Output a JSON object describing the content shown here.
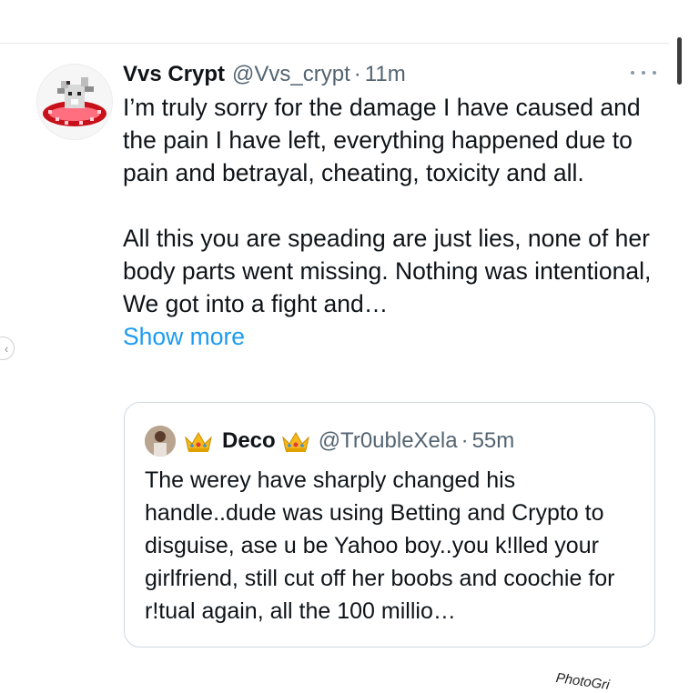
{
  "tweet": {
    "author_name": "Vvs Crypt",
    "author_handle": "@Vvs_crypt",
    "separator": "·",
    "time": "11m",
    "paragraphs": [
      "I’m truly sorry for the damage I have caused and the pain I have left, everything happened due to pain and betrayal, cheating, toxicity and all.",
      "All this you are speading are just lies, none of her body parts went missing. Nothing was intentional, We got into a fight and…"
    ],
    "show_more_label": "Show more"
  },
  "quote": {
    "author_name": "Deco",
    "author_handle": "@Tr0ubleXela",
    "separator": "·",
    "time": "55m",
    "text": "The werey have sharply changed his handle..dude was using Betting and Crypto to disguise, ase u be Yahoo boy..you k!lled your girlfriend, still cut off her boobs and coochie for r!tual again, all the 100 millio…"
  },
  "icons": {
    "more": "more-horizontal-icon",
    "crown": "crown-emoji-icon",
    "nav_back": "chevron-left-icon"
  },
  "colors": {
    "link": "#1d9bf0",
    "secondary_text": "#536471",
    "primary_text": "#0f1419"
  },
  "watermark": "PhotoGri"
}
